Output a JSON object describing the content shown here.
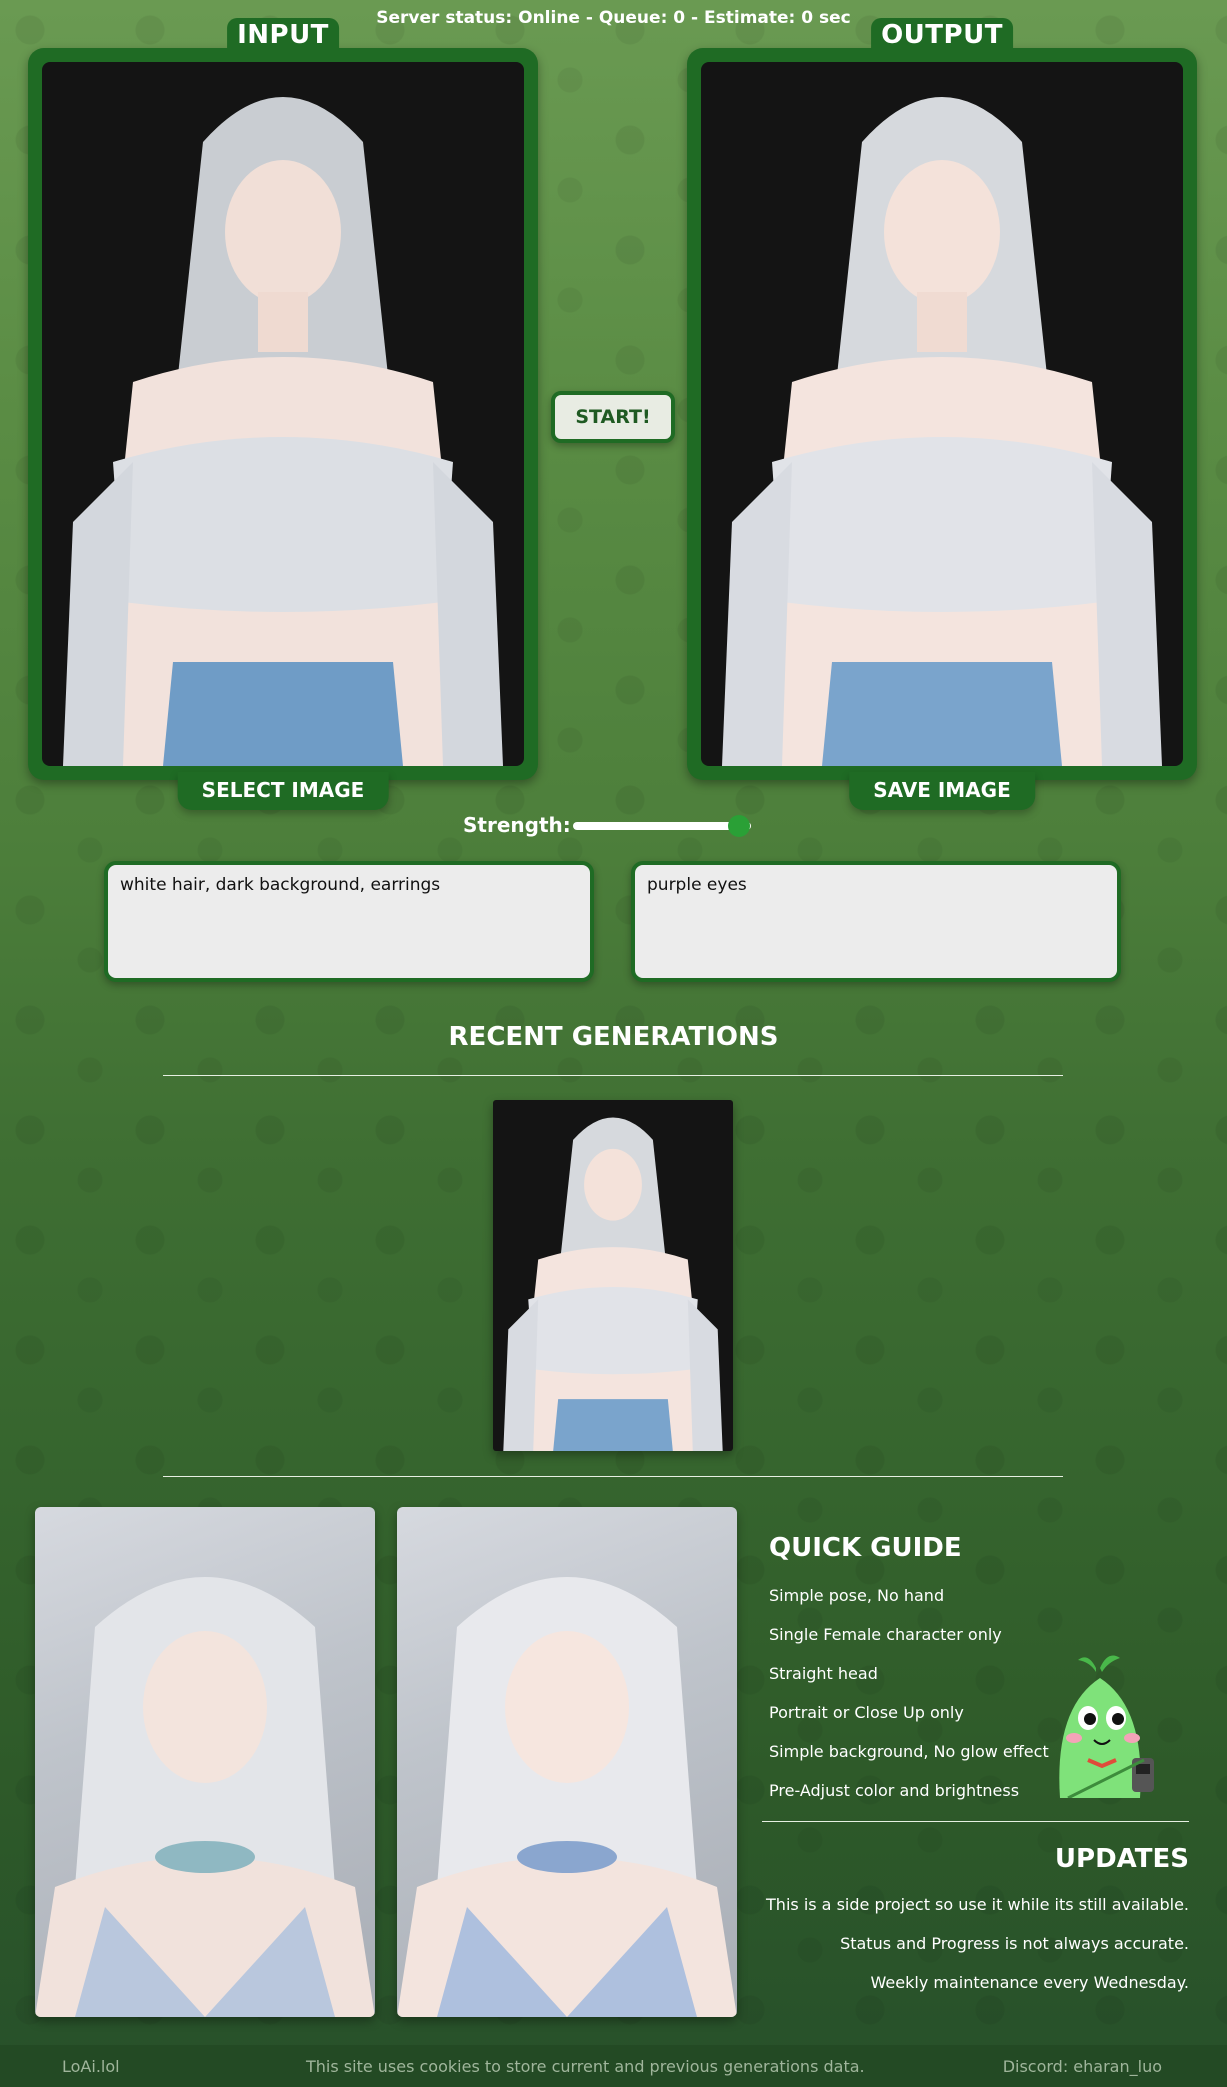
{
  "status": "Server status: Online - Queue: 0 - Estimate: 0 sec",
  "input_panel": {
    "label": "INPUT",
    "button": "SELECT IMAGE"
  },
  "output_panel": {
    "label": "OUTPUT",
    "button": "SAVE IMAGE"
  },
  "start_button": "START!",
  "strength": {
    "label": "Strength:",
    "value": 0.93
  },
  "prompts": {
    "positive": "white hair, dark background, earrings",
    "negative": "purple eyes"
  },
  "recent": {
    "title": "RECENT GENERATIONS"
  },
  "guide": {
    "title": "QUICK GUIDE",
    "items": [
      "Simple pose, No hand",
      "Single Female character only",
      "Straight head",
      "Portrait or Close Up only",
      "Simple background, No glow effect",
      "Pre-Adjust color and brightness"
    ]
  },
  "updates": {
    "title": "UPDATES",
    "items": [
      "This is a side project so use it while its still available.",
      "Status and Progress is not always accurate.",
      "Weekly maintenance every Wednesday."
    ]
  },
  "footer": {
    "left": "LoAi.lol",
    "center": "This site uses cookies to store current and previous generations data.",
    "right": "Discord: eharan_luo"
  },
  "colors": {
    "panel": "#1f6b24",
    "accent": "#2aa036",
    "prompt_bg": "#ececec",
    "footer_bg": "#234a24"
  }
}
